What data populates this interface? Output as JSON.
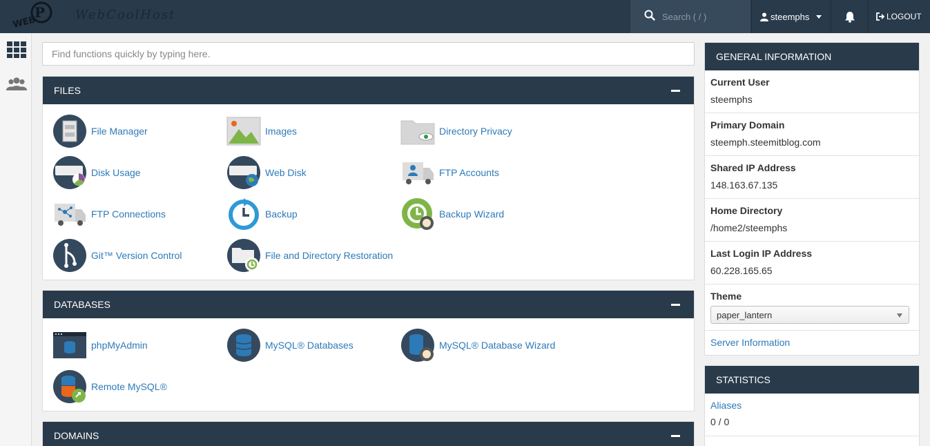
{
  "topbar": {
    "logo_text": "WebCoolHost",
    "search_placeholder": "Search ( / )",
    "username": "steemphs",
    "logout_label": "LOGOUT"
  },
  "main": {
    "quick_find_placeholder": "Find functions quickly by typing here."
  },
  "sections": {
    "files": {
      "title": "FILES",
      "items": [
        {
          "label": "File Manager",
          "icon": "file-manager-icon"
        },
        {
          "label": "Images",
          "icon": "images-icon"
        },
        {
          "label": "Directory Privacy",
          "icon": "directory-privacy-icon"
        },
        {
          "label": "Disk Usage",
          "icon": "disk-usage-icon"
        },
        {
          "label": "Web Disk",
          "icon": "web-disk-icon"
        },
        {
          "label": "FTP Accounts",
          "icon": "ftp-accounts-icon"
        },
        {
          "label": "FTP Connections",
          "icon": "ftp-connections-icon"
        },
        {
          "label": "Backup",
          "icon": "backup-icon"
        },
        {
          "label": "Backup Wizard",
          "icon": "backup-wizard-icon"
        },
        {
          "label": "Git™ Version Control",
          "icon": "git-icon"
        },
        {
          "label": "File and Directory Restoration",
          "icon": "file-restoration-icon"
        }
      ]
    },
    "databases": {
      "title": "DATABASES",
      "items": [
        {
          "label": "phpMyAdmin",
          "icon": "phpmyadmin-icon"
        },
        {
          "label": "MySQL® Databases",
          "icon": "mysql-databases-icon"
        },
        {
          "label": "MySQL® Database Wizard",
          "icon": "mysql-wizard-icon"
        },
        {
          "label": "Remote MySQL®",
          "icon": "remote-mysql-icon"
        }
      ]
    },
    "domains": {
      "title": "DOMAINS"
    }
  },
  "general_info": {
    "title": "GENERAL INFORMATION",
    "rows": [
      {
        "label": "Current User",
        "value": "steemphs"
      },
      {
        "label": "Primary Domain",
        "value": "steemph.steemitblog.com"
      },
      {
        "label": "Shared IP Address",
        "value": "148.163.67.135"
      },
      {
        "label": "Home Directory",
        "value": "/home2/steemphs"
      },
      {
        "label": "Last Login IP Address",
        "value": "60.228.165.65"
      }
    ],
    "theme_label": "Theme",
    "theme_value": "paper_lantern",
    "server_info_link": "Server Information"
  },
  "statistics": {
    "title": "STATISTICS",
    "aliases_label": "Aliases",
    "aliases_value": "0 / 0"
  },
  "colors": {
    "topbar": "#293a4a",
    "link": "#2d7ab8",
    "icon_navy": "#34495e"
  }
}
